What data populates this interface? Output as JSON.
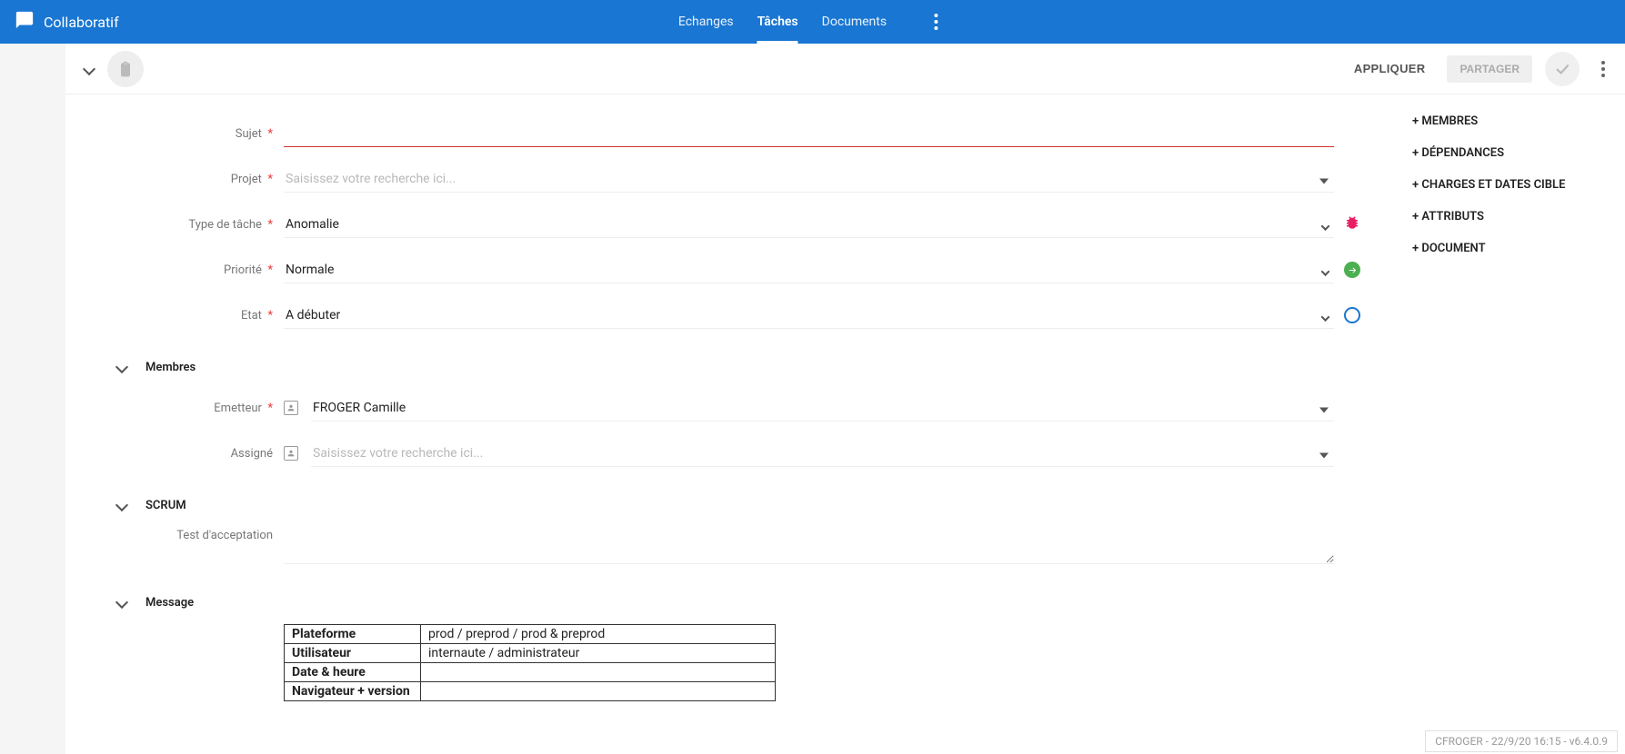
{
  "app": {
    "title": "Collaboratif"
  },
  "nav": {
    "exchanges": "Echanges",
    "tasks": "Tâches",
    "documents": "Documents"
  },
  "toolbar": {
    "apply": "APPLIQUER",
    "share": "PARTAGER"
  },
  "form": {
    "subject_label": "Sujet",
    "project_label": "Projet",
    "project_placeholder": "Saisissez votre recherche ici...",
    "tasktype_label": "Type de tâche",
    "tasktype_value": "Anomalie",
    "priority_label": "Priorité",
    "priority_value": "Normale",
    "state_label": "Etat",
    "state_value": "A débuter"
  },
  "sections": {
    "members": "Membres",
    "scrum": "SCRUM",
    "message": "Message"
  },
  "members": {
    "emitter_label": "Emetteur",
    "emitter_value": "FROGER Camille",
    "assignee_label": "Assigné",
    "assignee_placeholder": "Saisissez votre recherche ici..."
  },
  "scrum": {
    "test_label": "Test d'acceptation"
  },
  "message_table": {
    "platform_label": "Plateforme",
    "platform_value": "prod / preprod / prod & preprod",
    "user_label": "Utilisateur",
    "user_value": "internaute / administrateur",
    "datetime_label": "Date & heure",
    "datetime_value": "",
    "browser_label": "Navigateur + version",
    "browser_value": ""
  },
  "sidepanel": {
    "members": "+ MEMBRES",
    "dependencies": "+ DÉPENDANCES",
    "charges": "+ CHARGES ET DATES CIBLE",
    "attributes": "+ ATTRIBUTS",
    "document": "+ DOCUMENT"
  },
  "footer": "CFROGER - 22/9/20 16:15 - v6.4.0.9"
}
